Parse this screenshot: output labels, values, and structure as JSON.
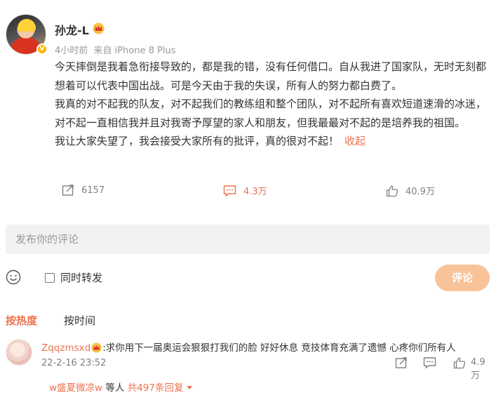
{
  "post": {
    "username": "孙龙-L",
    "time": "4小时前",
    "source": "来自 iPhone 8 Plus",
    "paragraphs": [
      "今天摔倒是我着急衔接导致的，都是我的错，没有任何借口。自从我进了国家队，无时无刻都想着可以代表中国出战。可是今天由于我的失误，所有人的努力都白费了。",
      "我真的对不起我的队友，对不起我们的教练组和整个团队，对不起所有喜欢短道速滑的冰迷，对不起一直相信我并且对我寄予厚望的家人和朋友，但我最最对不起的是培养我的祖国。",
      "我让大家失望了，我会接受大家所有的批评，真的很对不起！"
    ],
    "collapse_label": "收起",
    "repost_count": "6157",
    "comment_count": "4.3万",
    "like_count": "40.9万"
  },
  "composer": {
    "placeholder": "发布你的评论",
    "repost_label": "同时转发",
    "submit_label": "评论"
  },
  "sort": {
    "hot_label": "按热度",
    "time_label": "按时间"
  },
  "comment": {
    "user": "Zqqzmsxd",
    "text": ":求你用下一届奥运会狠狠打我们的脸 好好休息 竞技体育充满了遗憾 心疼你们所有人",
    "time": "22-2-16 23:52",
    "like_count": "4.9万",
    "reply_user": "w盛夏微凉w",
    "reply_mid": " 等人 ",
    "reply_count": "共497条回复"
  },
  "colors": {
    "accent": "#eb7350",
    "submit_disabled": "#f9c39a",
    "input_bg": "#f2f2f5"
  }
}
